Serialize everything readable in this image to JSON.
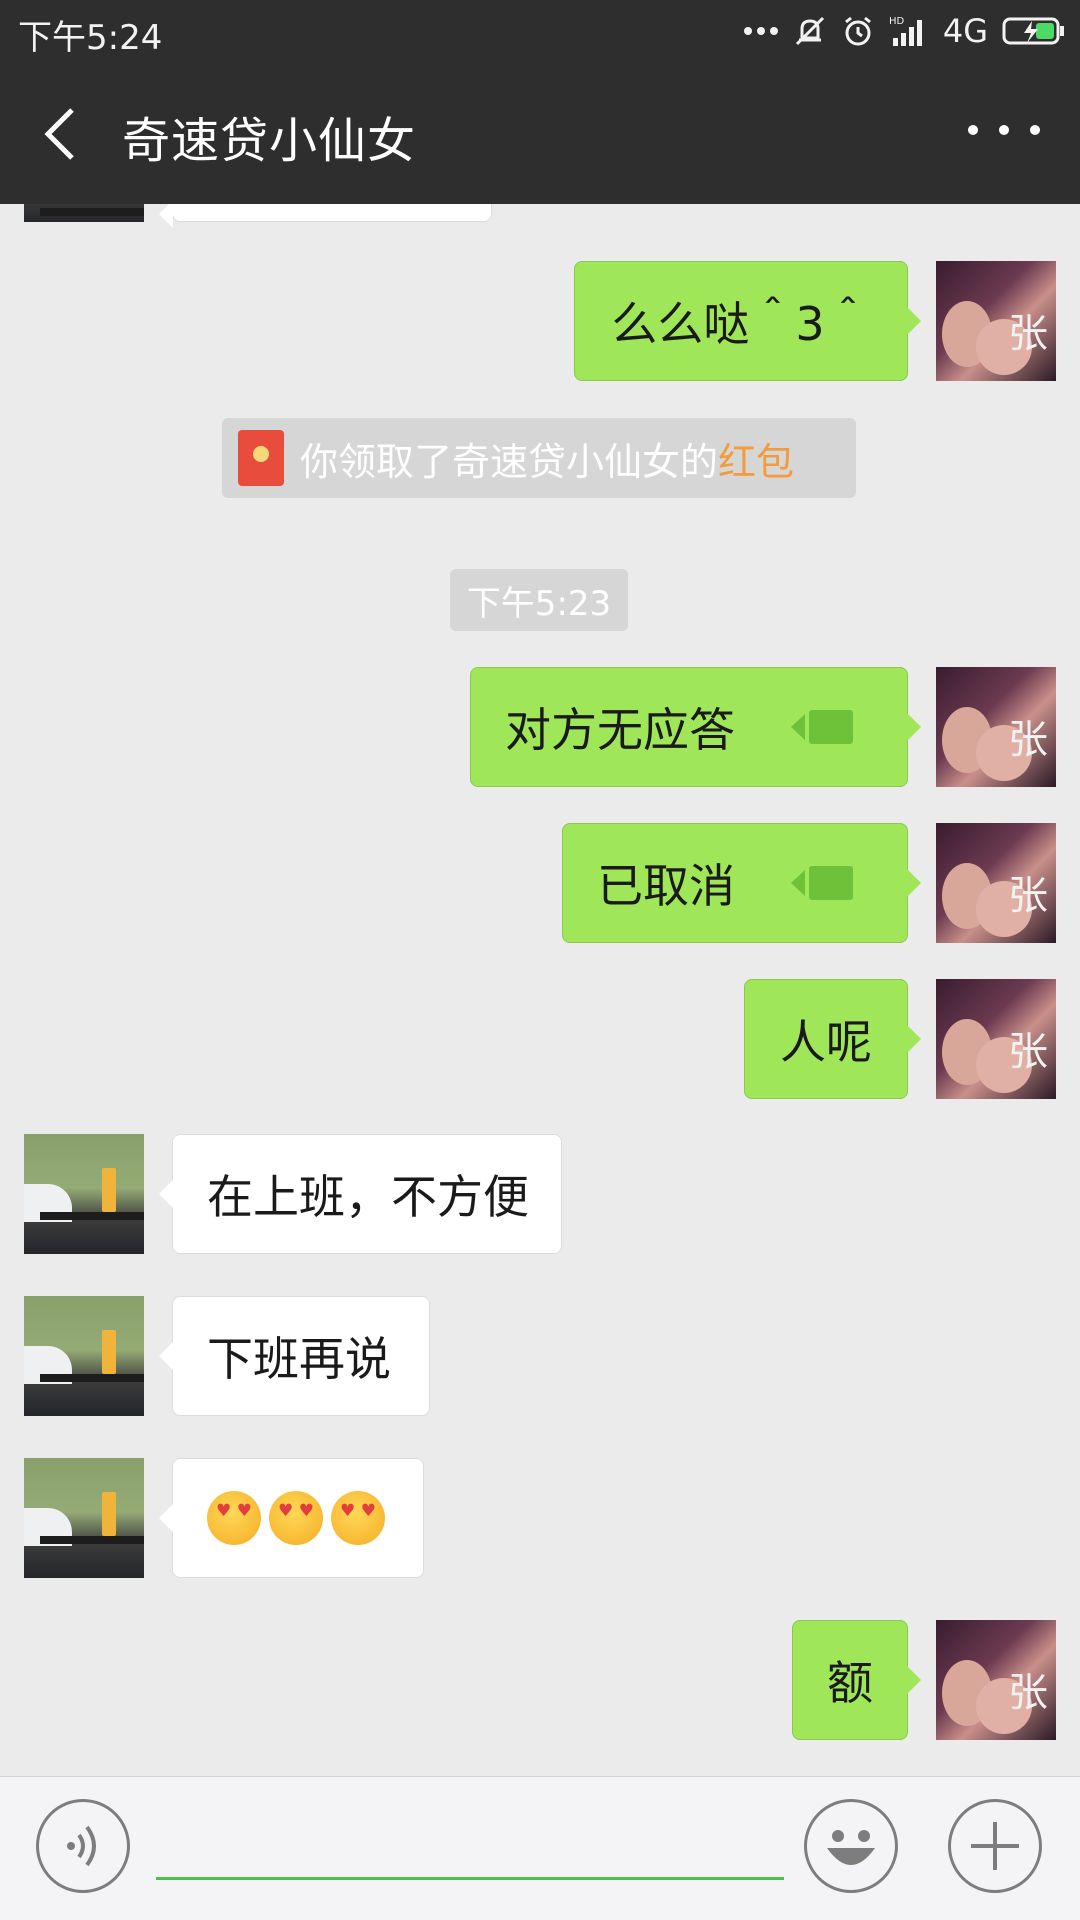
{
  "status_bar": {
    "time": "下午5:24",
    "network": "4G",
    "icons": [
      "more-dots-icon",
      "mute-icon",
      "alarm-icon",
      "hd-signal-icon",
      "battery-charging-icon"
    ]
  },
  "header": {
    "title": "奇速贷小仙女",
    "back_icon": "chevron-left-icon",
    "more_icon": "more-horizontal-icon"
  },
  "messages": [
    {
      "side": "out",
      "text": "么么哒＾3＾"
    },
    {
      "side": "system",
      "type": "red-packet",
      "text": "你领取了奇速贷小仙女的",
      "link": "红包"
    },
    {
      "side": "system",
      "type": "time",
      "text": "下午5:23"
    },
    {
      "side": "out",
      "text": "对方无应答",
      "icon": "video-call-icon"
    },
    {
      "side": "out",
      "text": "已取消",
      "icon": "video-call-icon"
    },
    {
      "side": "out",
      "text": "人呢"
    },
    {
      "side": "in",
      "text": "在上班，不方便"
    },
    {
      "side": "in",
      "text": "下班再说"
    },
    {
      "side": "in",
      "emoji": [
        "heart-eyes-emoji",
        "heart-eyes-emoji",
        "heart-eyes-emoji"
      ]
    },
    {
      "side": "out",
      "text": "额"
    }
  ],
  "avatars": {
    "me_label": "张"
  },
  "input_bar": {
    "voice_icon": "voice-icon",
    "input_value": "",
    "emoji_icon": "smiley-icon",
    "plus_icon": "plus-icon"
  },
  "colors": {
    "outgoing_bubble": "#9fe658",
    "incoming_bubble": "#ffffff",
    "chat_background": "#ebebeb",
    "header_background": "#2e2e2e",
    "red_packet_link": "#f39c3e",
    "input_underline": "#4cbf4c"
  }
}
